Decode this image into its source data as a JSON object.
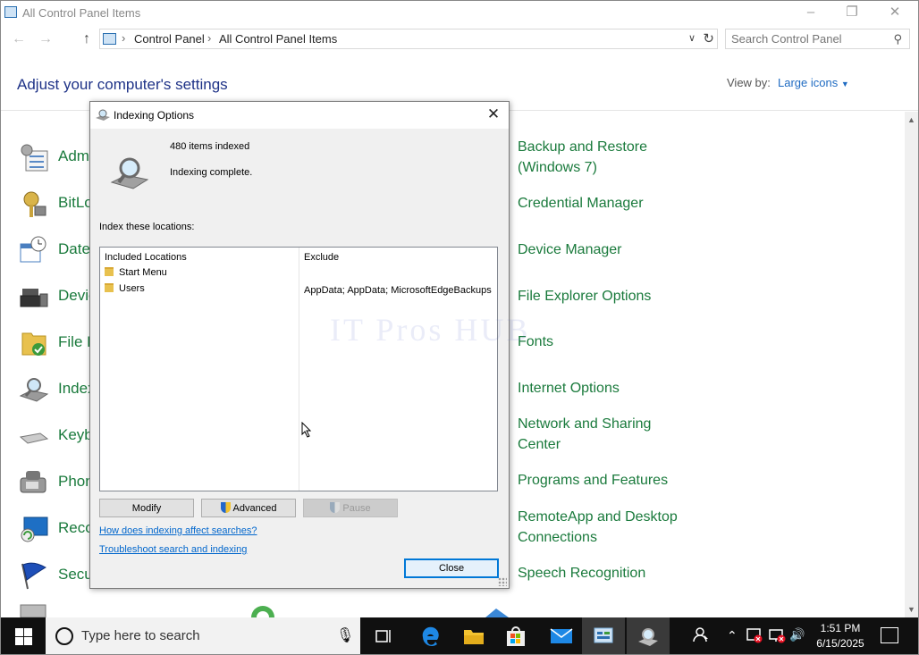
{
  "window": {
    "title": "All Control Panel Items"
  },
  "address": {
    "crumbs": [
      "Control Panel",
      "All Control Panel Items"
    ]
  },
  "search": {
    "placeholder": "Search Control Panel"
  },
  "header": {
    "title": "Adjust your computer's settings",
    "view_by_label": "View by:",
    "view_by_value": "Large icons"
  },
  "left_items": [
    {
      "label": "Adm",
      "icon": "admin-tools-icon"
    },
    {
      "label": "BitLo",
      "icon": "bitlocker-icon"
    },
    {
      "label": "Date",
      "icon": "date-time-icon"
    },
    {
      "label": "Devic",
      "icon": "devices-printers-icon"
    },
    {
      "label": "File H",
      "icon": "file-history-icon"
    },
    {
      "label": "Index",
      "icon": "indexing-icon"
    },
    {
      "label": "Keyb",
      "icon": "keyboard-icon"
    },
    {
      "label": "Phon",
      "icon": "phone-modem-icon"
    },
    {
      "label": "Reco",
      "icon": "recovery-icon"
    },
    {
      "label": "Secu",
      "icon": "security-flag-icon"
    }
  ],
  "right_items": [
    "Backup and Restore (Windows 7)",
    "Credential Manager",
    "Device Manager",
    "File Explorer Options",
    "Fonts",
    "Internet Options",
    "Network and Sharing Center",
    "Programs and Features",
    "RemoteApp and Desktop Connections",
    "Speech Recognition"
  ],
  "dialog": {
    "title": "Indexing Options",
    "items_indexed": "480 items indexed",
    "status": "Indexing complete.",
    "locations_label": "Index these locations:",
    "col_included": "Included Locations",
    "col_exclude": "Exclude",
    "rows": [
      {
        "location": "Start Menu",
        "exclude": ""
      },
      {
        "location": "Users",
        "exclude": "AppData; AppData; MicrosoftEdgeBackups"
      }
    ],
    "btn_modify": "Modify",
    "btn_advanced": "Advanced",
    "btn_pause": "Pause",
    "link_affect": "How does indexing affect searches?",
    "link_troubleshoot": "Troubleshoot search and indexing",
    "btn_close": "Close"
  },
  "watermark": "IT Pros HUB",
  "taskbar": {
    "search_placeholder": "Type here to search",
    "time": "1:51 PM",
    "date": "6/15/2025"
  },
  "colors": {
    "link_green": "#1a7a3c",
    "heading_blue": "#1e3287",
    "accent": "#0078d7"
  }
}
